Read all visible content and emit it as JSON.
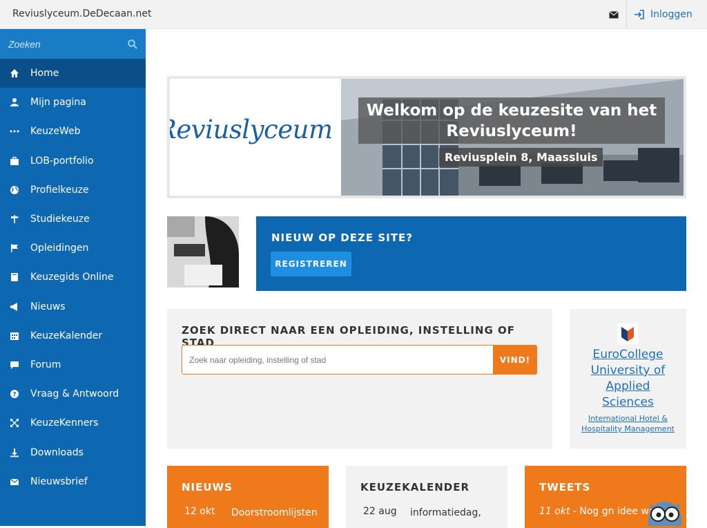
{
  "header": {
    "site_title": "Reviuslyceum.DeDecaan.net",
    "login_label": "Inloggen"
  },
  "sidebar": {
    "search_placeholder": "Zoeken",
    "items": [
      {
        "label": "Home",
        "icon": "home-icon",
        "active": true
      },
      {
        "label": "Mijn pagina",
        "icon": "user-icon"
      },
      {
        "label": "KeuzeWeb",
        "icon": "dots-icon"
      },
      {
        "label": "LOB-portfolio",
        "icon": "briefcase-icon"
      },
      {
        "label": "Profielkeuze",
        "icon": "globe-icon"
      },
      {
        "label": "Studiekeuze",
        "icon": "signpost-icon"
      },
      {
        "label": "Opleidingen",
        "icon": "flag-icon"
      },
      {
        "label": "Keuzegids Online",
        "icon": "book-icon"
      },
      {
        "label": "Nieuws",
        "icon": "megaphone-icon"
      },
      {
        "label": "KeuzeKalender",
        "icon": "calendar-icon"
      },
      {
        "label": "Forum",
        "icon": "chat-icon"
      },
      {
        "label": "Vraag & Antwoord",
        "icon": "question-icon"
      },
      {
        "label": "KeuzeKenners",
        "icon": "expand-icon"
      },
      {
        "label": "Downloads",
        "icon": "download-icon"
      },
      {
        "label": "Nieuwsbrief",
        "icon": "envelope-icon"
      }
    ]
  },
  "banner": {
    "logo_text": "Reviuslyceum",
    "welcome_line1": "Welkom op de keuzesite van het",
    "welcome_line2": "Reviuslyceum!",
    "address": "Reviusplein 8, Maassluis"
  },
  "new_on_site": {
    "title": "NIEUW OP DEZE SITE?",
    "button_label": "REGISTREREN"
  },
  "search_section": {
    "title": "ZOEK DIRECT NAAR EEN OPLEIDING, INSTELLING OF STAD",
    "placeholder": "Zoek naar opleiding, instelling of stad",
    "button_label": "VIND!"
  },
  "ad": {
    "name_line1": "EuroCollege",
    "name_line2": "University of",
    "name_line3": "Applied",
    "name_line4": "Sciences",
    "sub_line1": "International Hotel &",
    "sub_line2": "Hospitality Management"
  },
  "news": {
    "title": "NIEUWS",
    "date": "12 okt",
    "text": "Doorstroomlijsten"
  },
  "calendar": {
    "title": "KEUZEKALENDER",
    "date": "22 aug",
    "text": "informatiedag,"
  },
  "tweets": {
    "title": "TWEETS",
    "date": "11 okt",
    "text": " - Nog gn idee wat je"
  },
  "colors": {
    "sidebar_bg": "#0e68b1",
    "sidebar_active": "#0a4f89",
    "accent_orange": "#ee7a1c",
    "link_blue": "#1f6fb5"
  }
}
